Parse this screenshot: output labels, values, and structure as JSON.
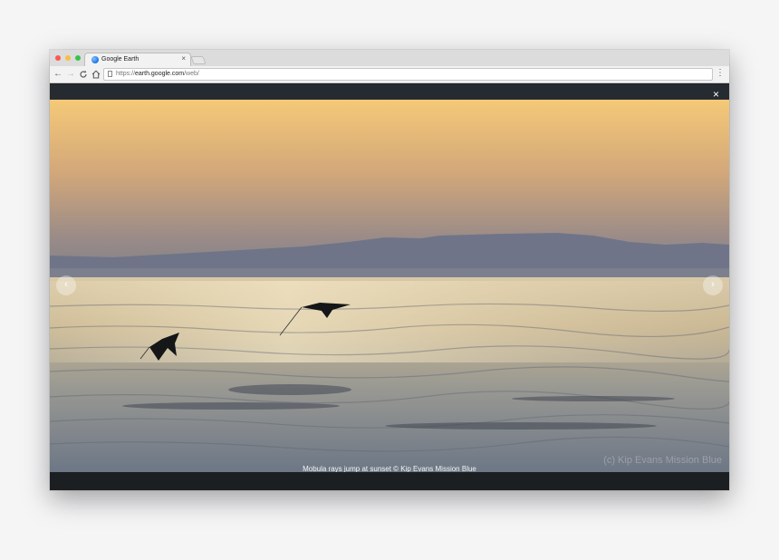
{
  "browser": {
    "tab_title": "Google Earth",
    "tab_close": "×",
    "url_scheme": "https://",
    "url_host": "earth.google.com",
    "url_path": "/web/",
    "icons": {
      "back": "←",
      "forward": "→",
      "reload": "C",
      "home": "⌂",
      "menu": "⋮"
    }
  },
  "viewer": {
    "close": "×",
    "prev": "‹",
    "next": "›",
    "caption": "Mobula rays jump at sunset © Kip Evans Mission Blue",
    "watermark": "(c) Kip Evans Mission Blue"
  },
  "colors": {
    "sky_top": "#f5c977",
    "sea": "#6d7786",
    "traffic_close": "#fc5753",
    "traffic_min": "#fdbc40",
    "traffic_max": "#33c748"
  }
}
